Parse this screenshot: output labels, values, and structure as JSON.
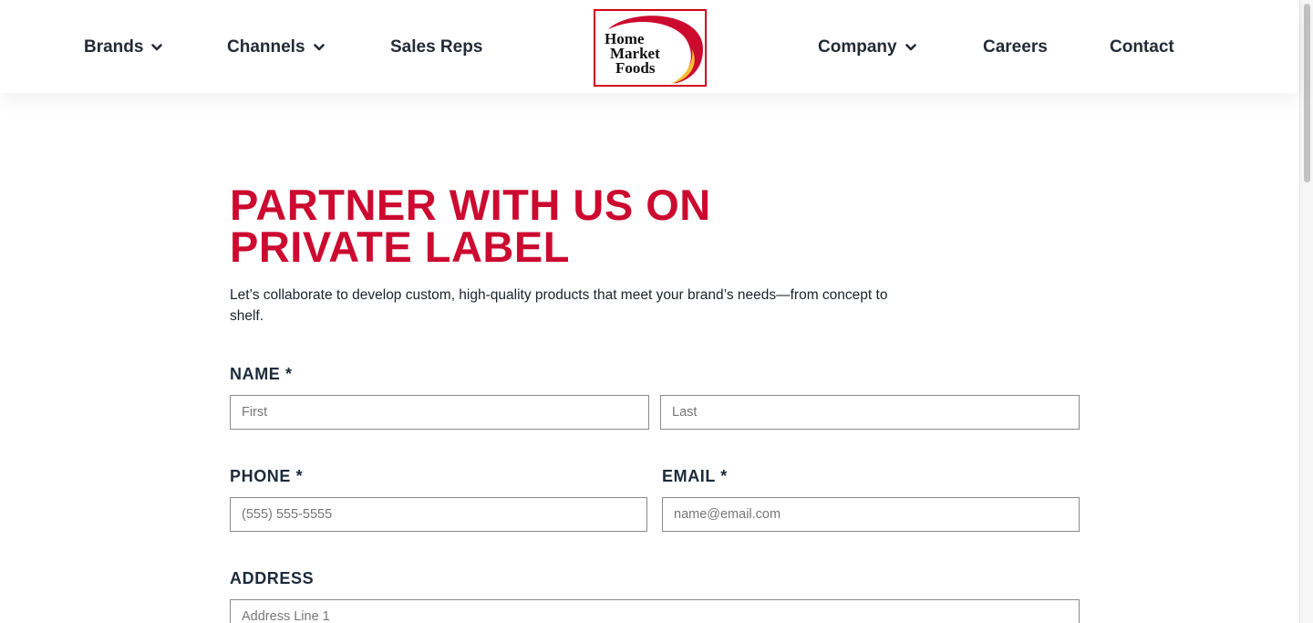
{
  "nav": {
    "left": [
      {
        "label": "Brands",
        "has_dropdown": true
      },
      {
        "label": "Channels",
        "has_dropdown": true
      },
      {
        "label": "Sales Reps",
        "has_dropdown": false
      }
    ],
    "right": [
      {
        "label": "Company",
        "has_dropdown": true
      },
      {
        "label": "Careers",
        "has_dropdown": false
      },
      {
        "label": "Contact",
        "has_dropdown": false
      }
    ],
    "logo": {
      "line1": "Home",
      "line2": "Market",
      "line3": "Foods"
    }
  },
  "page": {
    "title_line1": "PARTNER WITH US ON",
    "title_line2": "PRIVATE LABEL",
    "intro": "Let’s collaborate to develop custom, high-quality products that meet your brand’s needs—from concept to shelf."
  },
  "form": {
    "name_label": "NAME *",
    "first_placeholder": "First",
    "last_placeholder": "Last",
    "phone_label": "PHONE *",
    "phone_placeholder": "(555) 555-5555",
    "email_label": "EMAIL *",
    "email_placeholder": "name@email.com",
    "address_label": "ADDRESS",
    "address1_placeholder": "Address Line 1"
  },
  "colors": {
    "brand_red": "#cc0a2f",
    "logo_yellow": "#f2c230",
    "text_dark": "#242a36"
  },
  "icons": {
    "dropdown": "chevron-down-icon"
  }
}
